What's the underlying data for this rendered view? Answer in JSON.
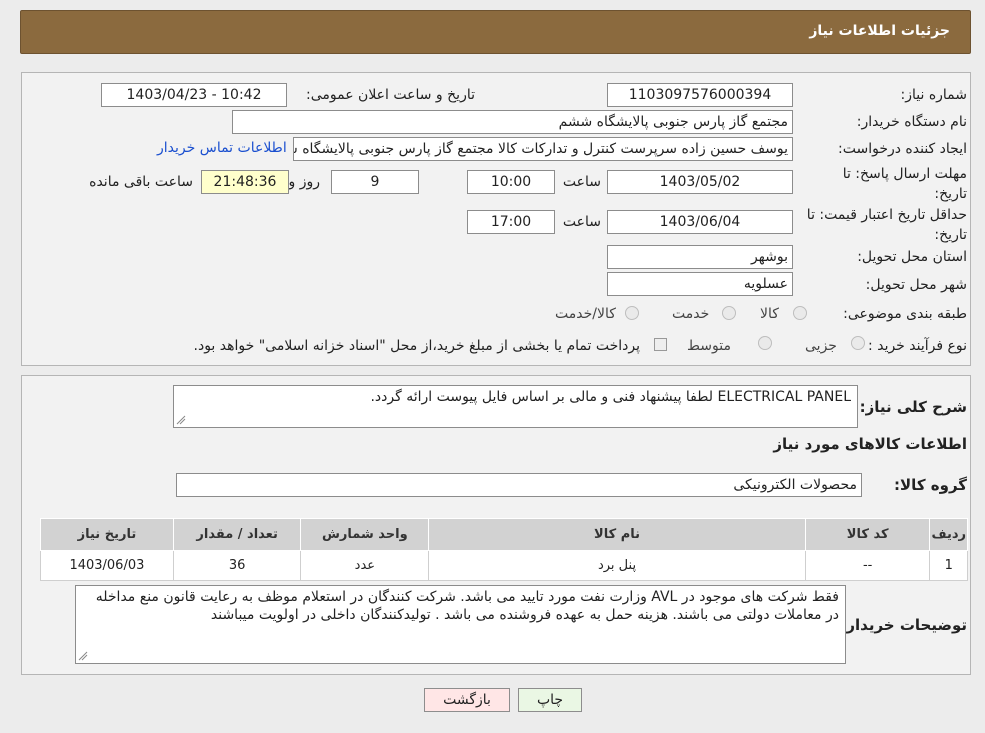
{
  "header": {
    "title": "جزئیات اطلاعات نیاز"
  },
  "form": {
    "need_number_label": "شماره نیاز:",
    "need_number": "1103097576000394",
    "announce_label": "تاریخ و ساعت اعلان عمومی:",
    "announce_value": "1403/04/23 - 10:42",
    "buyer_label": "نام دستگاه خریدار:",
    "buyer_value": "مجتمع گاز پارس جنوبی  پالایشگاه ششم",
    "creator_label": "ایجاد کننده درخواست:",
    "creator_value": "یوسف حسین زاده سرپرست کنترل و تدارکات کالا مجتمع گاز پارس جنوبی  پالایشگاه ششم",
    "contact_link": "اطلاعات تماس خریدار",
    "deadline_label": "مهلت ارسال پاسخ: تا تاریخ:",
    "deadline_date": "1403/05/02",
    "time_label": "ساعت",
    "deadline_time": "10:00",
    "days_value": "9",
    "days_label": "روز و",
    "remaining_value": "21:48:36",
    "remaining_label": "ساعت باقی مانده",
    "validity_label": "حداقل تاریخ اعتبار قیمت: تا تاریخ:",
    "validity_date": "1403/06/04",
    "validity_time": "17:00",
    "province_label": "استان محل تحویل:",
    "province_value": "بوشهر",
    "city_label": "شهر محل تحویل:",
    "city_value": "عسلویه",
    "category_label": "طبقه بندی موضوعی:",
    "category_options": [
      "کالا",
      "خدمت",
      "کالا/خدمت"
    ],
    "process_label": "نوع فرآیند خرید :",
    "process_options": [
      "جزیی",
      "متوسط"
    ],
    "payment_note": "پرداخت تمام یا بخشی از مبلغ خرید،از محل \"اسناد خزانه اسلامی\" خواهد بود."
  },
  "description": {
    "label": "شرح کلی نیاز:",
    "text": "ELECTRICAL PANEL لطفا پیشنهاد فنی و مالی بر اساس فایل پیوست ارائه گردد."
  },
  "goods": {
    "section_title": "اطلاعات کالاهای مورد نیاز",
    "group_label": "گروه کالا:",
    "group_value": "محصولات الکترونیکی",
    "columns": [
      "ردیف",
      "کد کالا",
      "نام کالا",
      "واحد شمارش",
      "تعداد / مقدار",
      "تاریخ نیاز"
    ],
    "rows": [
      {
        "row": "1",
        "code": "--",
        "name": "پنل برد",
        "unit": "عدد",
        "qty": "36",
        "date": "1403/06/03"
      }
    ]
  },
  "buyer_notes": {
    "label": "توضیحات خریدار:",
    "text": "فقط شرکت های موجود در AVL وزارت نفت مورد تایید می باشد. شرکت کنندگان در استعلام موظف به رعایت قانون منع مداخله در معاملات دولتی می باشند. هزینه حمل به عهده فروشنده می باشد . تولیدکنندگان داخلی در اولویت میباشند"
  },
  "buttons": {
    "print": "چاپ",
    "back": "بازگشت"
  },
  "colors": {
    "header": "#8b6a3e",
    "link": "#1a4fcf",
    "remaining_bg": "#ffffcc"
  }
}
